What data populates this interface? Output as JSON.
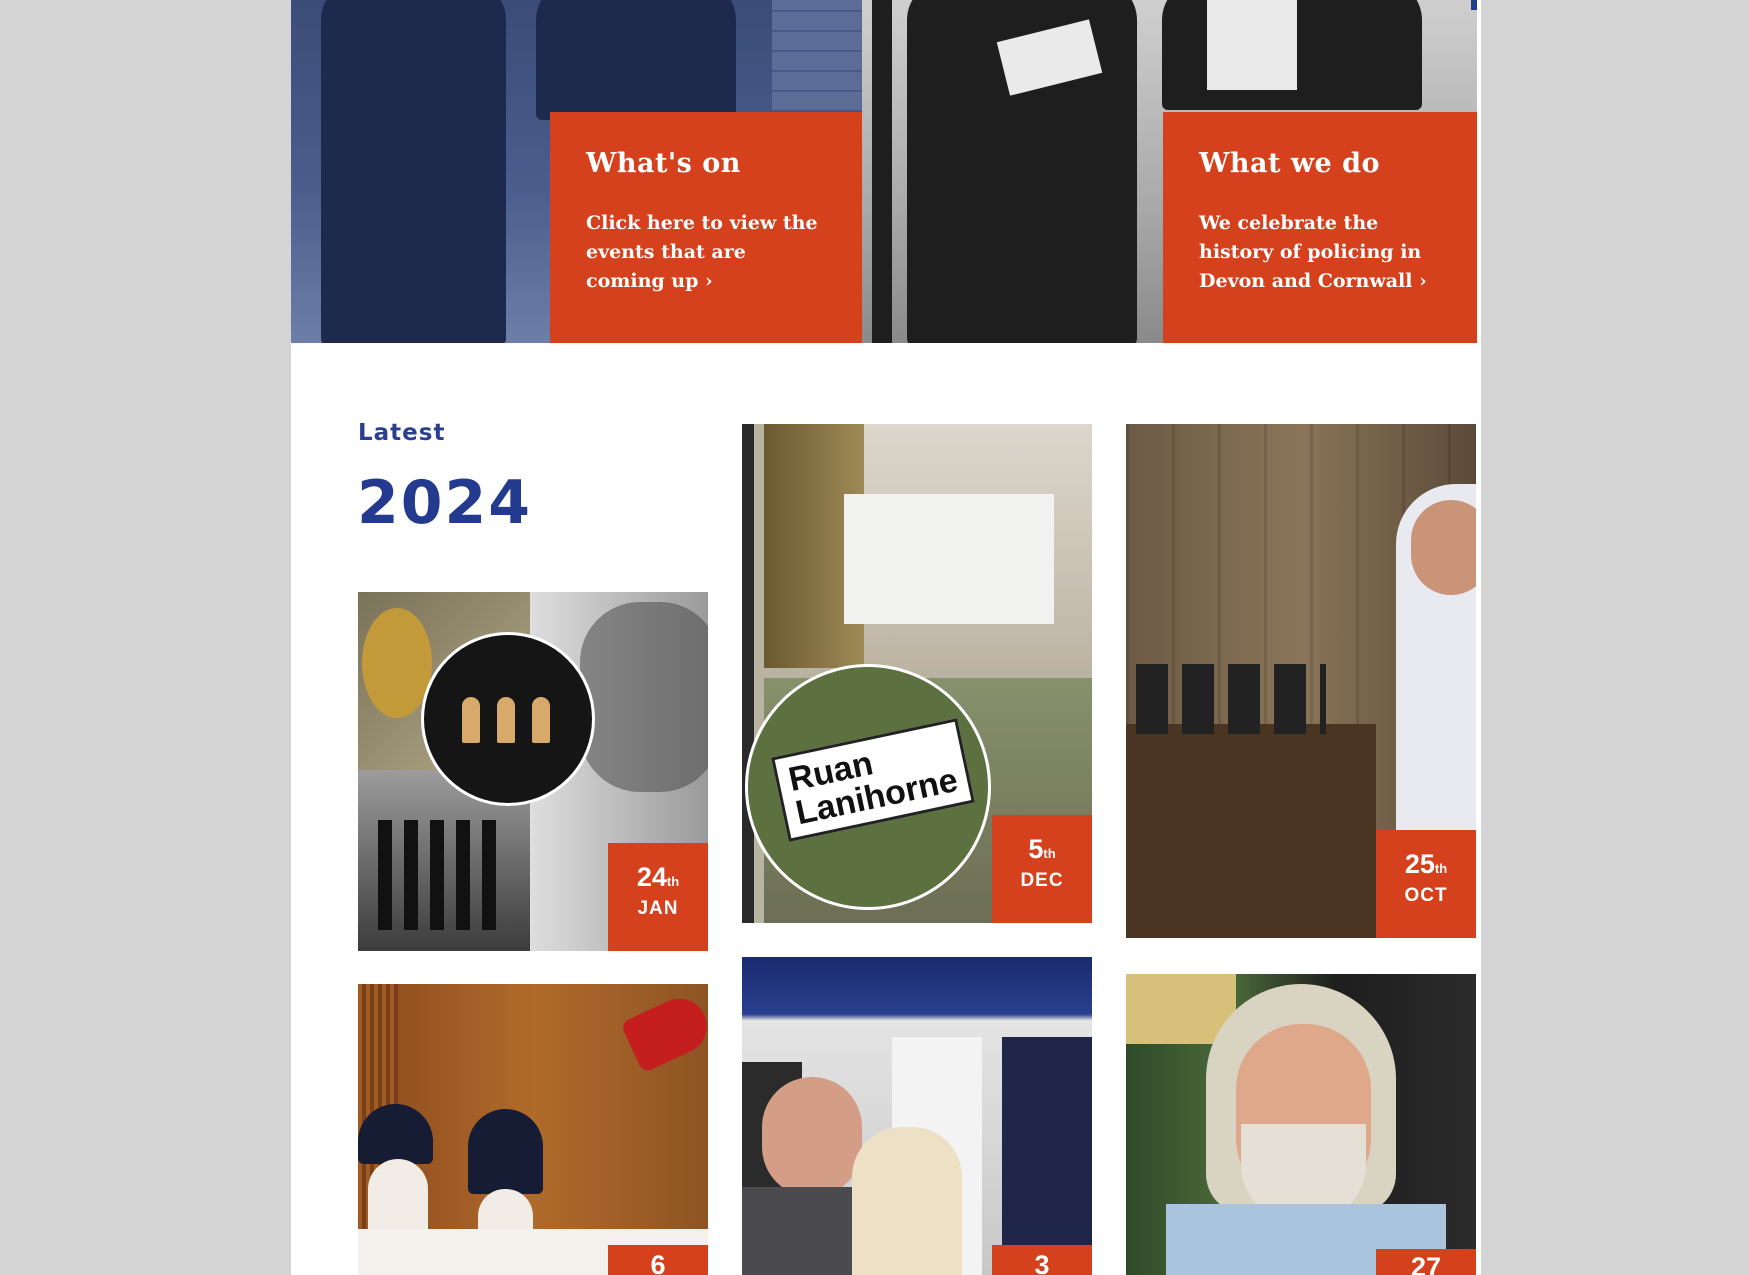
{
  "hero": {
    "whats_on": {
      "title": "What's on",
      "text": "Click here to view the events that are coming up ›"
    },
    "what_we_do": {
      "title": "What we do",
      "text": "We celebrate the history of policing in Devon and Cornwall ›"
    }
  },
  "latest": {
    "label": "Latest",
    "year": "2024"
  },
  "tiles": [
    {
      "day": "24",
      "suffix": "th",
      "month": "JAN"
    },
    {
      "day": "5",
      "suffix": "th",
      "month": "DEC",
      "sign_line1": "Ruan",
      "sign_line2": "Lanihorne"
    },
    {
      "day": "25",
      "suffix": "th",
      "month": "OCT"
    },
    {
      "day": "6",
      "suffix": "",
      "month": ""
    },
    {
      "day": "3",
      "suffix": "",
      "month": ""
    },
    {
      "day": "27",
      "suffix": "",
      "month": ""
    }
  ],
  "colors": {
    "accent": "#d4411c",
    "brand_blue": "#233a8e",
    "page_bg": "#d4d4d4"
  }
}
